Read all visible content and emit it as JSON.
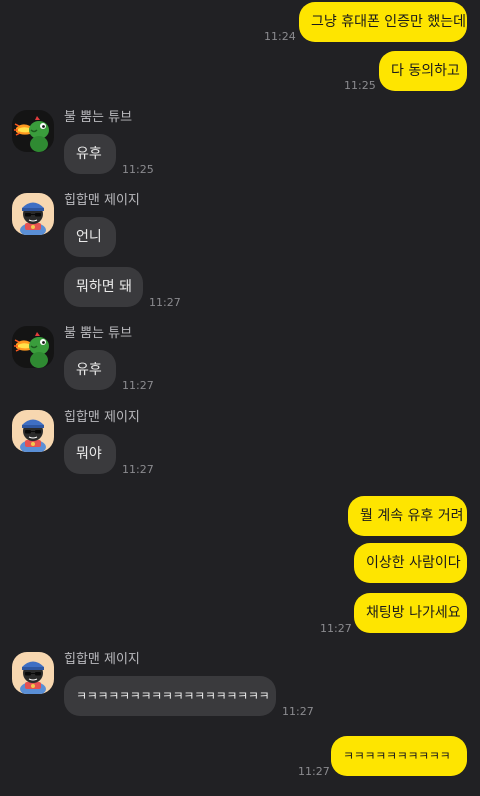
{
  "chat": {
    "colors": {
      "background": "#212124",
      "my_bubble": "#FEE500",
      "their_bubble": "#3a3a3d",
      "time_text": "#8b8b8f"
    },
    "messages": [
      {
        "id": "m1",
        "text": "그냥 휴대폰 인증만 했는데",
        "time": "11:24"
      },
      {
        "id": "m2",
        "text": "다 동의하고",
        "time": "11:25"
      },
      {
        "id": "m3",
        "sender": "불 뿜는 튜브",
        "avatar": "tube-fire-avatar",
        "text": "유후",
        "time": "11:25"
      },
      {
        "id": "m4",
        "sender": "힙합맨 제이지",
        "avatar": "jay-g-avatar",
        "text": "언니"
      },
      {
        "id": "m5",
        "text": "뭐하면 돼",
        "time": "11:27"
      },
      {
        "id": "m6",
        "sender": "불 뿜는 튜브",
        "avatar": "tube-fire-avatar",
        "text": "유후",
        "time": "11:27"
      },
      {
        "id": "m7",
        "sender": "힙합맨 제이지",
        "avatar": "jay-g-avatar",
        "text": "뭐야",
        "time": "11:27"
      },
      {
        "id": "m8",
        "text": "뭘 계속 유후 거려"
      },
      {
        "id": "m9",
        "text": "이상한 사람이다"
      },
      {
        "id": "m10",
        "text": "채팅방 나가세요",
        "time": "11:27"
      },
      {
        "id": "m11",
        "sender": "힙합맨 제이지",
        "avatar": "jay-g-avatar",
        "text": "ㅋㅋㅋㅋㅋㅋㅋㅋㅋㅋㅋㅋㅋㅋㅋㅋㅋㅋ",
        "time": "11:27"
      },
      {
        "id": "m12",
        "text": "ㅋㅋㅋㅋㅋㅋㅋㅋㅋㅋ",
        "time": "11:27"
      }
    ]
  }
}
